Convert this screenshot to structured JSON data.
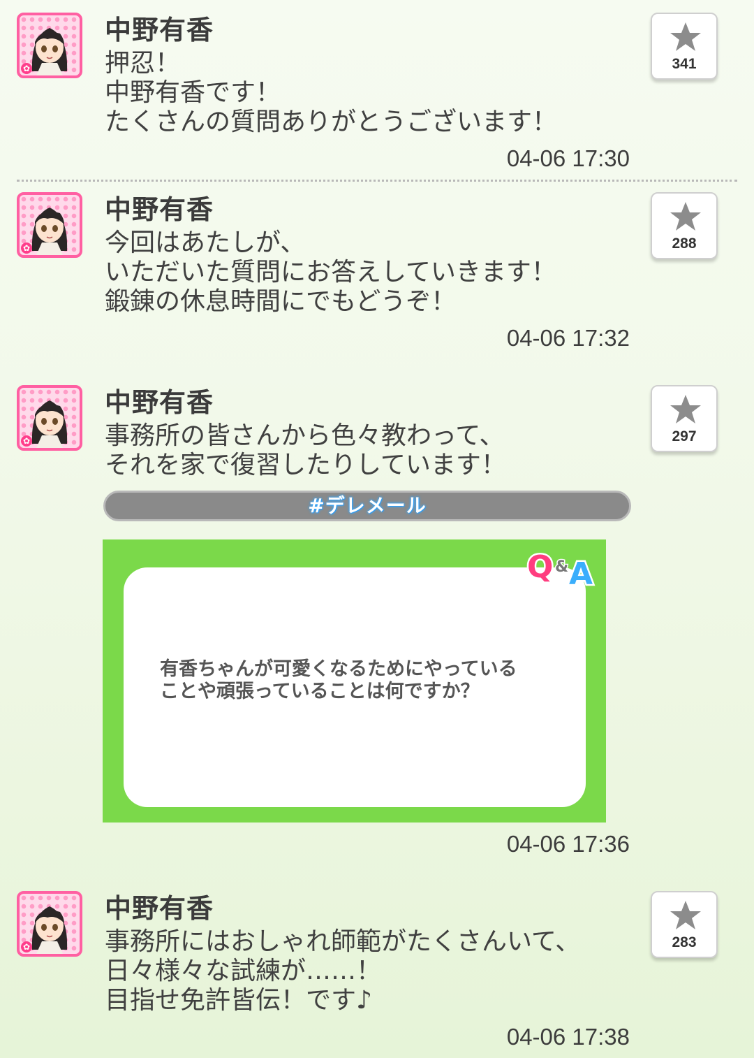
{
  "posts": [
    {
      "author": "中野有香",
      "text": "押忍！\n中野有香です！\nたくさんの質問ありがとうございます！",
      "time": "04-06 17:30",
      "stars": "341"
    },
    {
      "author": "中野有香",
      "text": "今回はあたしが、\nいただいた質問にお答えしていきます！\n鍛錬の休息時間にでもどうぞ！",
      "time": "04-06 17:32",
      "stars": "288"
    },
    {
      "author": "中野有香",
      "text": "事務所の皆さんから色々教わって、\nそれを家で復習したりしています！",
      "time": "04-06 17:36",
      "stars": "297",
      "hashtag": "#デレメール",
      "qa_card": {
        "logo": "Q&A",
        "question": "有香ちゃんが可愛くなるためにやっている\nことや頑張っていることは何ですか？"
      }
    },
    {
      "author": "中野有香",
      "text": "事務所にはおしゃれ師範がたくさんいて、\n日々様々な試練が……！\n目指せ免許皆伝！です♪",
      "time": "04-06 17:38",
      "stars": "283"
    }
  ],
  "icons": {
    "avatar": "avatar-icon",
    "star": "star-icon",
    "flower": "flower-icon"
  },
  "colors": {
    "avatar_border": "#ff5fa2",
    "qa_green": "#7bd94a",
    "hashtag_glow": "#35a8ff"
  }
}
